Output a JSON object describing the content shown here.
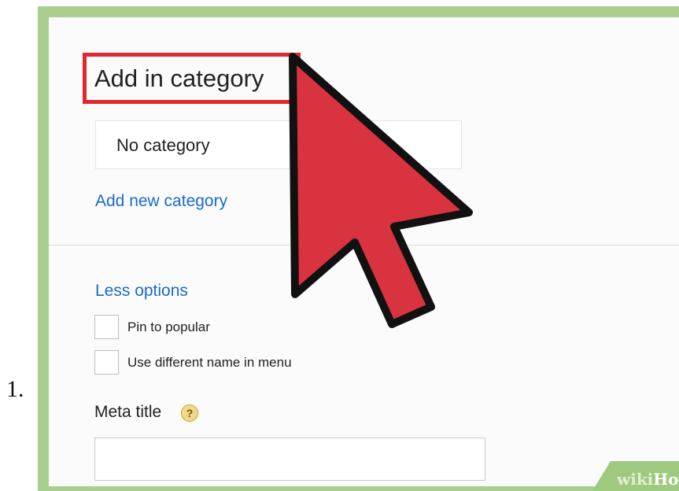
{
  "step": {
    "number": "1."
  },
  "section": {
    "title": "Add in category"
  },
  "category_select": {
    "selected": "No category"
  },
  "links": {
    "add_category": "Add new category",
    "less_options": "Less options"
  },
  "options": [
    {
      "label": "Pin to popular",
      "checked": false
    },
    {
      "label": "Use different name in menu",
      "checked": false
    }
  ],
  "meta": {
    "label": "Meta title",
    "help_glyph": "?",
    "value": ""
  },
  "watermark": {
    "wiki": "wiki",
    "how": "How"
  },
  "colors": {
    "highlight": "#e2282f",
    "arrow": "#d9333f",
    "link": "#1a6bc9",
    "frame": "#a9cf8e"
  }
}
